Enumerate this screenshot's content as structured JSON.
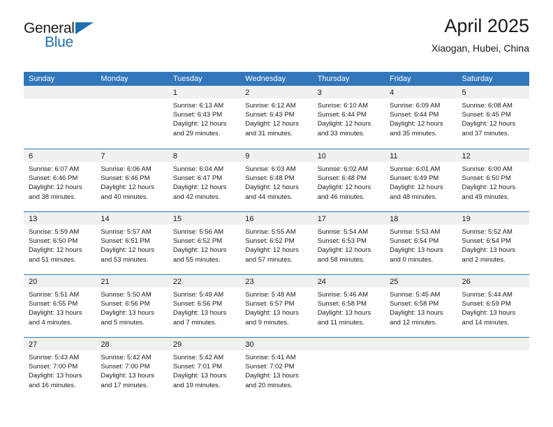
{
  "brand": {
    "line1": "General",
    "line2": "Blue",
    "triangle_icon": "triangle-icon",
    "accent_color": "#1f6fb2"
  },
  "header": {
    "title": "April 2025",
    "subtitle": "Xiaogan, Hubei, China"
  },
  "colors": {
    "header_blue": "#3277bc",
    "date_band": "#f0f0f0",
    "text": "#1a1a1a"
  },
  "calendar": {
    "weekday_headers": [
      "Sunday",
      "Monday",
      "Tuesday",
      "Wednesday",
      "Thursday",
      "Friday",
      "Saturday"
    ],
    "weeks": [
      [
        {
          "day": "",
          "sunrise": "",
          "sunset": "",
          "daylight_line1": "",
          "daylight_line2": ""
        },
        {
          "day": "",
          "sunrise": "",
          "sunset": "",
          "daylight_line1": "",
          "daylight_line2": ""
        },
        {
          "day": "1",
          "sunrise": "Sunrise: 6:13 AM",
          "sunset": "Sunset: 6:43 PM",
          "daylight_line1": "Daylight: 12 hours",
          "daylight_line2": "and 29 minutes."
        },
        {
          "day": "2",
          "sunrise": "Sunrise: 6:12 AM",
          "sunset": "Sunset: 6:43 PM",
          "daylight_line1": "Daylight: 12 hours",
          "daylight_line2": "and 31 minutes."
        },
        {
          "day": "3",
          "sunrise": "Sunrise: 6:10 AM",
          "sunset": "Sunset: 6:44 PM",
          "daylight_line1": "Daylight: 12 hours",
          "daylight_line2": "and 33 minutes."
        },
        {
          "day": "4",
          "sunrise": "Sunrise: 6:09 AM",
          "sunset": "Sunset: 6:44 PM",
          "daylight_line1": "Daylight: 12 hours",
          "daylight_line2": "and 35 minutes."
        },
        {
          "day": "5",
          "sunrise": "Sunrise: 6:08 AM",
          "sunset": "Sunset: 6:45 PM",
          "daylight_line1": "Daylight: 12 hours",
          "daylight_line2": "and 37 minutes."
        }
      ],
      [
        {
          "day": "6",
          "sunrise": "Sunrise: 6:07 AM",
          "sunset": "Sunset: 6:46 PM",
          "daylight_line1": "Daylight: 12 hours",
          "daylight_line2": "and 38 minutes."
        },
        {
          "day": "7",
          "sunrise": "Sunrise: 6:06 AM",
          "sunset": "Sunset: 6:46 PM",
          "daylight_line1": "Daylight: 12 hours",
          "daylight_line2": "and 40 minutes."
        },
        {
          "day": "8",
          "sunrise": "Sunrise: 6:04 AM",
          "sunset": "Sunset: 6:47 PM",
          "daylight_line1": "Daylight: 12 hours",
          "daylight_line2": "and 42 minutes."
        },
        {
          "day": "9",
          "sunrise": "Sunrise: 6:03 AM",
          "sunset": "Sunset: 6:48 PM",
          "daylight_line1": "Daylight: 12 hours",
          "daylight_line2": "and 44 minutes."
        },
        {
          "day": "10",
          "sunrise": "Sunrise: 6:02 AM",
          "sunset": "Sunset: 6:48 PM",
          "daylight_line1": "Daylight: 12 hours",
          "daylight_line2": "and 46 minutes."
        },
        {
          "day": "11",
          "sunrise": "Sunrise: 6:01 AM",
          "sunset": "Sunset: 6:49 PM",
          "daylight_line1": "Daylight: 12 hours",
          "daylight_line2": "and 48 minutes."
        },
        {
          "day": "12",
          "sunrise": "Sunrise: 6:00 AM",
          "sunset": "Sunset: 6:50 PM",
          "daylight_line1": "Daylight: 12 hours",
          "daylight_line2": "and 49 minutes."
        }
      ],
      [
        {
          "day": "13",
          "sunrise": "Sunrise: 5:59 AM",
          "sunset": "Sunset: 6:50 PM",
          "daylight_line1": "Daylight: 12 hours",
          "daylight_line2": "and 51 minutes."
        },
        {
          "day": "14",
          "sunrise": "Sunrise: 5:57 AM",
          "sunset": "Sunset: 6:51 PM",
          "daylight_line1": "Daylight: 12 hours",
          "daylight_line2": "and 53 minutes."
        },
        {
          "day": "15",
          "sunrise": "Sunrise: 5:56 AM",
          "sunset": "Sunset: 6:52 PM",
          "daylight_line1": "Daylight: 12 hours",
          "daylight_line2": "and 55 minutes."
        },
        {
          "day": "16",
          "sunrise": "Sunrise: 5:55 AM",
          "sunset": "Sunset: 6:52 PM",
          "daylight_line1": "Daylight: 12 hours",
          "daylight_line2": "and 57 minutes."
        },
        {
          "day": "17",
          "sunrise": "Sunrise: 5:54 AM",
          "sunset": "Sunset: 6:53 PM",
          "daylight_line1": "Daylight: 12 hours",
          "daylight_line2": "and 58 minutes."
        },
        {
          "day": "18",
          "sunrise": "Sunrise: 5:53 AM",
          "sunset": "Sunset: 6:54 PM",
          "daylight_line1": "Daylight: 13 hours",
          "daylight_line2": "and 0 minutes."
        },
        {
          "day": "19",
          "sunrise": "Sunrise: 5:52 AM",
          "sunset": "Sunset: 6:54 PM",
          "daylight_line1": "Daylight: 13 hours",
          "daylight_line2": "and 2 minutes."
        }
      ],
      [
        {
          "day": "20",
          "sunrise": "Sunrise: 5:51 AM",
          "sunset": "Sunset: 6:55 PM",
          "daylight_line1": "Daylight: 13 hours",
          "daylight_line2": "and 4 minutes."
        },
        {
          "day": "21",
          "sunrise": "Sunrise: 5:50 AM",
          "sunset": "Sunset: 6:56 PM",
          "daylight_line1": "Daylight: 13 hours",
          "daylight_line2": "and 5 minutes."
        },
        {
          "day": "22",
          "sunrise": "Sunrise: 5:49 AM",
          "sunset": "Sunset: 6:56 PM",
          "daylight_line1": "Daylight: 13 hours",
          "daylight_line2": "and 7 minutes."
        },
        {
          "day": "23",
          "sunrise": "Sunrise: 5:48 AM",
          "sunset": "Sunset: 6:57 PM",
          "daylight_line1": "Daylight: 13 hours",
          "daylight_line2": "and 9 minutes."
        },
        {
          "day": "24",
          "sunrise": "Sunrise: 5:46 AM",
          "sunset": "Sunset: 6:58 PM",
          "daylight_line1": "Daylight: 13 hours",
          "daylight_line2": "and 11 minutes."
        },
        {
          "day": "25",
          "sunrise": "Sunrise: 5:45 AM",
          "sunset": "Sunset: 6:58 PM",
          "daylight_line1": "Daylight: 13 hours",
          "daylight_line2": "and 12 minutes."
        },
        {
          "day": "26",
          "sunrise": "Sunrise: 5:44 AM",
          "sunset": "Sunset: 6:59 PM",
          "daylight_line1": "Daylight: 13 hours",
          "daylight_line2": "and 14 minutes."
        }
      ],
      [
        {
          "day": "27",
          "sunrise": "Sunrise: 5:43 AM",
          "sunset": "Sunset: 7:00 PM",
          "daylight_line1": "Daylight: 13 hours",
          "daylight_line2": "and 16 minutes."
        },
        {
          "day": "28",
          "sunrise": "Sunrise: 5:42 AM",
          "sunset": "Sunset: 7:00 PM",
          "daylight_line1": "Daylight: 13 hours",
          "daylight_line2": "and 17 minutes."
        },
        {
          "day": "29",
          "sunrise": "Sunrise: 5:42 AM",
          "sunset": "Sunset: 7:01 PM",
          "daylight_line1": "Daylight: 13 hours",
          "daylight_line2": "and 19 minutes."
        },
        {
          "day": "30",
          "sunrise": "Sunrise: 5:41 AM",
          "sunset": "Sunset: 7:02 PM",
          "daylight_line1": "Daylight: 13 hours",
          "daylight_line2": "and 20 minutes."
        },
        {
          "day": "",
          "sunrise": "",
          "sunset": "",
          "daylight_line1": "",
          "daylight_line2": ""
        },
        {
          "day": "",
          "sunrise": "",
          "sunset": "",
          "daylight_line1": "",
          "daylight_line2": ""
        },
        {
          "day": "",
          "sunrise": "",
          "sunset": "",
          "daylight_line1": "",
          "daylight_line2": ""
        }
      ]
    ]
  }
}
